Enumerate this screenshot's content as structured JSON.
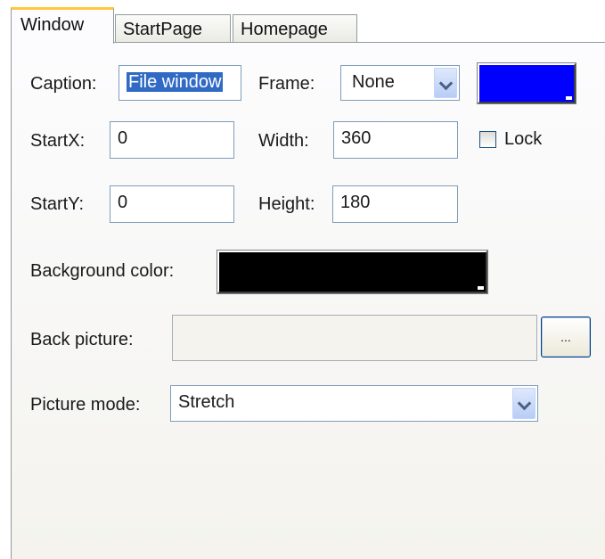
{
  "tabs": [
    "Window",
    "StartPage",
    "Homepage"
  ],
  "caption": {
    "label": "Caption:",
    "value": "File window"
  },
  "frame": {
    "label": "Frame:",
    "value": "None"
  },
  "frame_color": "#0000ff",
  "startx": {
    "label": "StartX:",
    "value": "0"
  },
  "width": {
    "label": "Width:",
    "value": "360"
  },
  "lock": {
    "label": "Lock",
    "checked": false
  },
  "starty": {
    "label": "StartY:",
    "value": "0"
  },
  "height": {
    "label": "Height:",
    "value": "180"
  },
  "background": {
    "label": "Background color:",
    "color": "#000000"
  },
  "back_picture": {
    "label": "Back picture:",
    "value": "",
    "browse_label": "..."
  },
  "picture_mode": {
    "label": "Picture mode:",
    "value": "Stretch"
  }
}
